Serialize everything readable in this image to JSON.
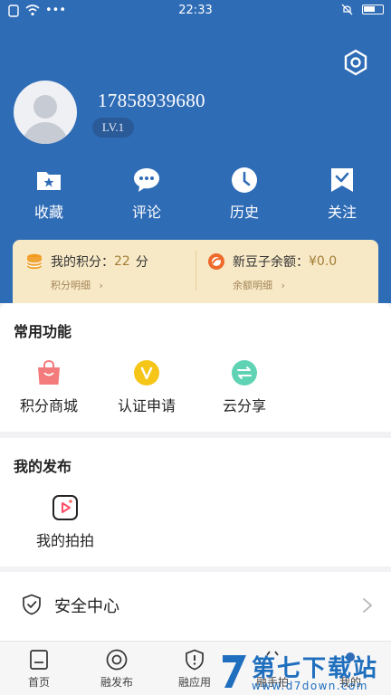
{
  "status_bar": {
    "time": "22:33",
    "dots": "•••"
  },
  "profile": {
    "phone": "17858939680",
    "level": "LV.1"
  },
  "actions": [
    {
      "label": "收藏",
      "icon": "bookmark-folder-icon"
    },
    {
      "label": "评论",
      "icon": "comment-icon"
    },
    {
      "label": "历史",
      "icon": "clock-icon"
    },
    {
      "label": "关注",
      "icon": "follow-check-icon"
    }
  ],
  "points_card": {
    "points_label": "我的积分：",
    "points_value": "22",
    "points_unit": "分",
    "points_detail": "积分明细",
    "balance_label": "新豆子余额：",
    "balance_value": "¥0.0",
    "balance_detail": "余额明细"
  },
  "common_functions": {
    "title": "常用功能",
    "items": [
      {
        "label": "积分商城",
        "icon": "shopping-bag-icon",
        "color": "#f47b7b"
      },
      {
        "label": "认证申请",
        "icon": "verify-v-icon",
        "color": "#f5c518"
      },
      {
        "label": "云分享",
        "icon": "share-arrows-icon",
        "color": "#5fd3b3"
      }
    ]
  },
  "my_posts": {
    "title": "我的发布",
    "items": [
      {
        "label": "我的拍拍",
        "icon": "video-play-icon"
      }
    ]
  },
  "security": {
    "label": "安全中心",
    "icon": "shield-icon"
  },
  "tabbar": [
    {
      "label": "首页",
      "icon": "home-doc-icon"
    },
    {
      "label": "融发布",
      "icon": "publish-circle-icon"
    },
    {
      "label": "融应用",
      "icon": "app-shield-icon"
    },
    {
      "label": "融手拍",
      "icon": "camera-icon"
    },
    {
      "label": "我的",
      "icon": "user-icon"
    }
  ],
  "watermark": {
    "text": "第七下载站",
    "url": "www.d7down.com"
  },
  "colors": {
    "header_blue": "#2f6cb6",
    "card_bg": "#f8e9c6",
    "accent_gold": "#a27d36"
  }
}
